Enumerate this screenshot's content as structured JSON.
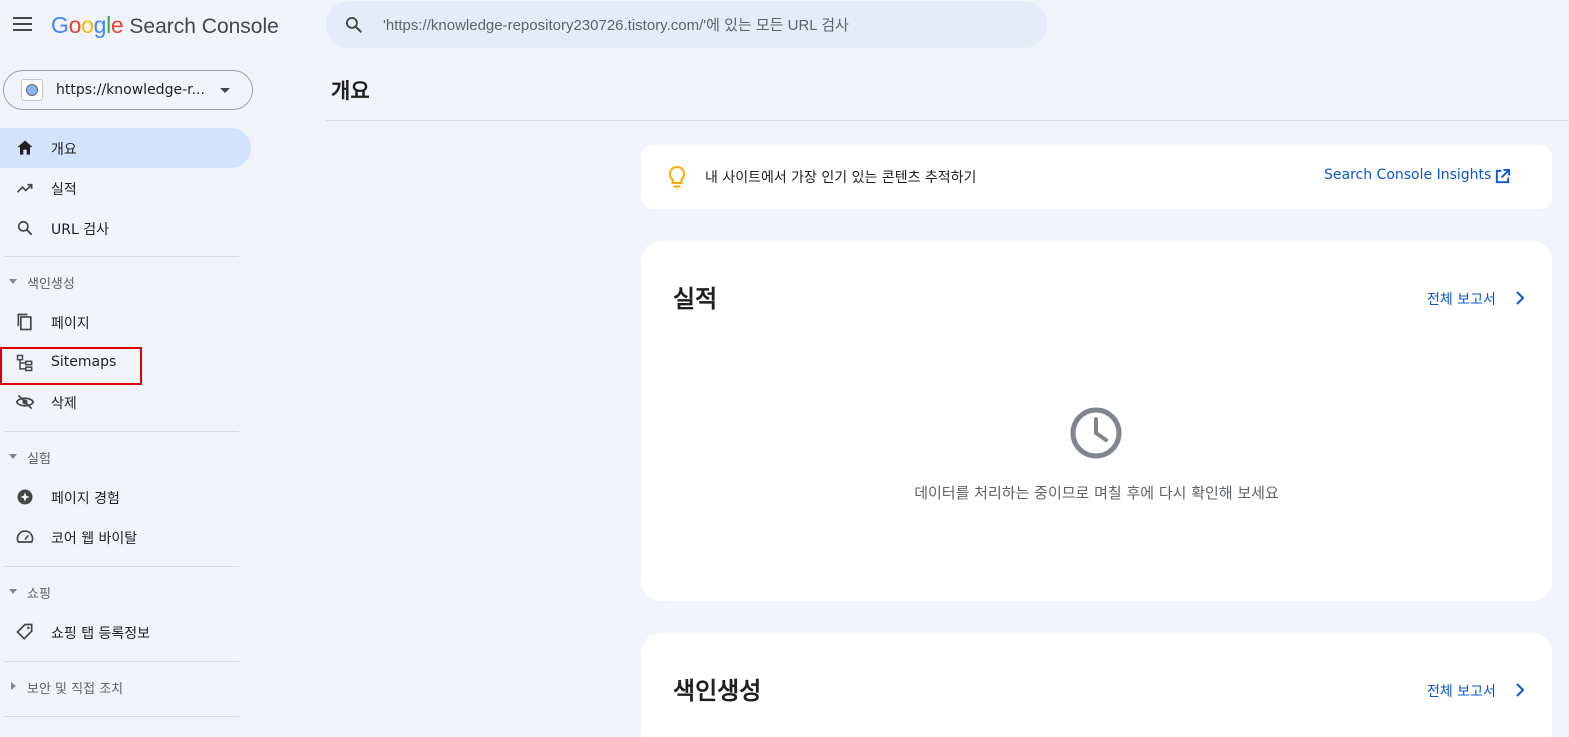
{
  "app": {
    "logo": {
      "letters": [
        "G",
        "o",
        "o",
        "g",
        "l",
        "e"
      ],
      "colors": [
        "#4285F4",
        "#EA4335",
        "#FBBC05",
        "#4285F4",
        "#34A853",
        "#EA4335"
      ],
      "product": "Search Console"
    },
    "menu_icon": "hamburger-menu-icon"
  },
  "search": {
    "placeholder": "'https://knowledge-repository230726.tistory.com/'에 있는 모든 URL 검사",
    "icon": "search-icon"
  },
  "property": {
    "label": "https://knowledge-r...",
    "icon": "globe-icon"
  },
  "sidebar": {
    "items": [
      {
        "label": "개요",
        "icon": "home-icon",
        "active": true
      },
      {
        "label": "실적",
        "icon": "trending-up-icon",
        "active": false
      },
      {
        "label": "URL 검사",
        "icon": "search-icon",
        "active": false
      }
    ],
    "sections": [
      {
        "label": "색인생성",
        "expanded": true,
        "items": [
          {
            "label": "페이지",
            "icon": "pages-icon"
          },
          {
            "label": "Sitemaps",
            "icon": "sitemap-icon",
            "highlighted": true
          },
          {
            "label": "삭제",
            "icon": "eye-off-icon"
          }
        ]
      },
      {
        "label": "실험",
        "expanded": true,
        "items": [
          {
            "label": "페이지 경험",
            "icon": "star-circle-icon"
          },
          {
            "label": "코어 웹 바이탈",
            "icon": "speedometer-icon"
          }
        ]
      },
      {
        "label": "쇼핑",
        "expanded": true,
        "items": [
          {
            "label": "쇼핑 탭 등록정보",
            "icon": "tag-icon"
          }
        ]
      },
      {
        "label": "보안 및 직접 조치",
        "expanded": false,
        "items": []
      }
    ]
  },
  "main": {
    "title": "개요",
    "insight": {
      "text": "내 사이트에서 가장 인기 있는 콘텐츠 추적하기",
      "link": "Search Console Insights",
      "icon": "lightbulb-icon",
      "link_icon": "open-in-new-icon"
    },
    "cards": [
      {
        "title": "실적",
        "link": "전체 보고서",
        "empty_message": "데이터를 처리하는 중이므로 며칠 후에 다시 확인해 보세요",
        "icon": "clock-icon"
      },
      {
        "title": "색인생성",
        "link": "전체 보고서"
      }
    ]
  },
  "colors": {
    "accent": "#0b57d0",
    "active_nav": "#d3e3fd",
    "background": "#f1f4fb",
    "highlight": "#e00000",
    "bulb": "#f9ab00"
  }
}
